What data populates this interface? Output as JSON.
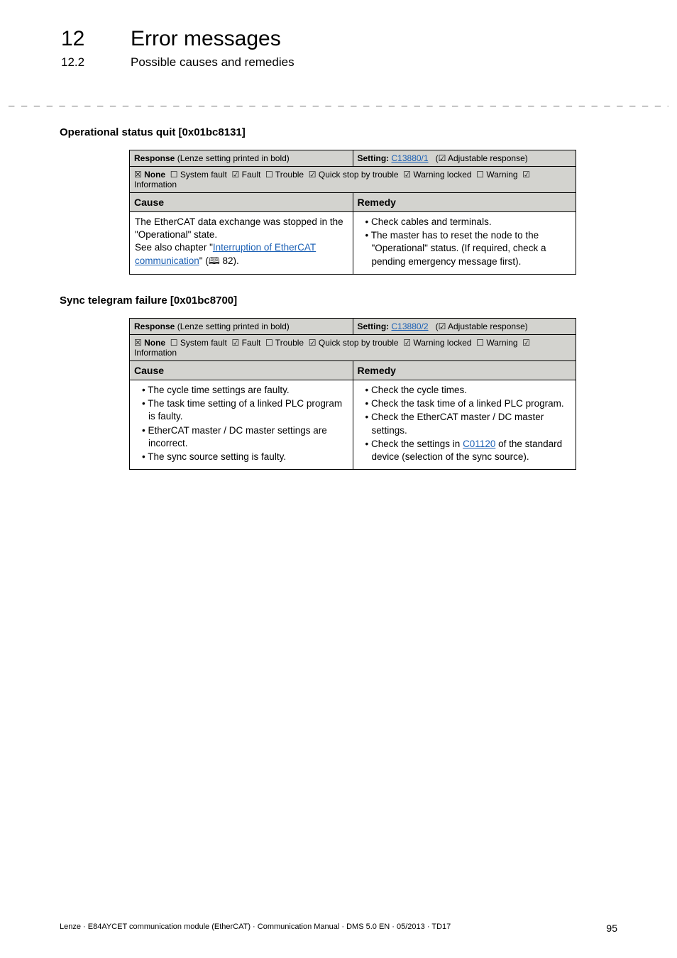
{
  "header": {
    "chapter_num": "12",
    "chapter_title": "Error messages",
    "section_num": "12.2",
    "section_title": "Possible causes and remedies"
  },
  "dashes": "_ _ _ _ _ _ _ _ _ _ _ _ _ _ _ _ _ _ _ _ _ _ _ _ _ _ _ _ _ _ _ _ _ _ _ _ _ _ _ _ _ _ _ _ _ _ _ _ _ _ _ _ _ _ _ _ _ _ _ _ _ _ _ _",
  "sections": [
    {
      "title": "Operational status quit [0x01bc8131]",
      "response": {
        "label": "Response",
        "paren": "(Lenze setting printed in bold)",
        "setting_label": "Setting:",
        "setting_link": "C13880/1",
        "setting_suffix": "(☑ Adjustable response)"
      },
      "checkbox_line": "☒ None  ☐ System fault  ☑ Fault  ☐ Trouble  ☑ Quick stop by trouble  ☑ Warning locked  ☐ Warning  ☑ Information",
      "none_label": "None",
      "cause_head": "Cause",
      "remedy_head": "Remedy",
      "cause_lines": [
        "The EtherCAT data exchange was stopped in the \"Operational\" state.",
        "See also chapter \""
      ],
      "cause_link_text": "Interruption of EtherCAT communication",
      "cause_link_suffix": "\" (🕮 82).",
      "remedy_items": [
        "Check cables and terminals.",
        "The master has to reset the node to the \"Operational\" status. (If required, check a pending emergency message first)."
      ]
    },
    {
      "title": "Sync telegram failure [0x01bc8700]",
      "response": {
        "label": "Response",
        "paren": "(Lenze setting printed in bold)",
        "setting_label": "Setting:",
        "setting_link": "C13880/2",
        "setting_suffix": "(☑ Adjustable response)"
      },
      "checkbox_line": "☒ None  ☐ System fault  ☑ Fault  ☐ Trouble  ☑ Quick stop by trouble  ☑ Warning locked  ☐ Warning  ☑ Information",
      "none_label": "None",
      "cause_head": "Cause",
      "remedy_head": "Remedy",
      "cause_items": [
        "The cycle time settings are faulty.",
        "The task time setting of a linked PLC program is faulty.",
        "EtherCAT master / DC master settings are incorrect.",
        "The sync source setting is faulty."
      ],
      "remedy_items": [
        "Check the cycle times.",
        "Check the task time of a linked PLC program.",
        "Check the EtherCAT master / DC master settings."
      ],
      "remedy_link_prefix": "Check the settings in ",
      "remedy_link_text": "C01120",
      "remedy_link_suffix": " of the standard device (selection of the sync source)."
    }
  ],
  "footer": {
    "left": "Lenze · E84AYCET communication module (EtherCAT) · Communication Manual · DMS 5.0 EN · 05/2013 · TD17",
    "page": "95"
  }
}
